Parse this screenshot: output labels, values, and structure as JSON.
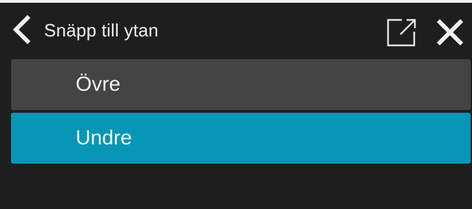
{
  "header": {
    "title": "Snäpp till ytan",
    "back_icon": "chevron-left-icon",
    "popout_icon": "popout-icon",
    "close_icon": "close-icon"
  },
  "options": [
    {
      "label": "Övre",
      "selected": false
    },
    {
      "label": "Undre",
      "selected": true
    }
  ],
  "colors": {
    "background": "#1e1e1f",
    "option_default": "#444444",
    "option_selected": "#0896b7",
    "text": "#f4f4f4"
  }
}
